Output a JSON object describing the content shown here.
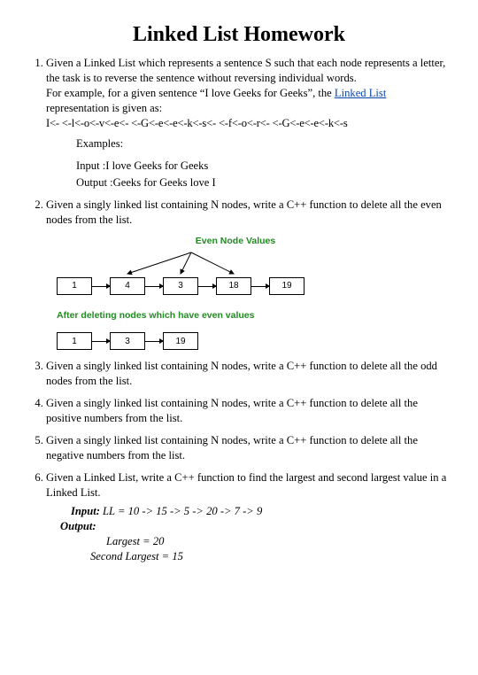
{
  "title": "Linked List Homework",
  "q1": {
    "p1": "Given a Linked List which represents a sentence S such that each node represents a letter, the task is to reverse the sentence without reversing individual words.",
    "p2a": "For example, for a given sentence “I love Geeks for Geeks”, the ",
    "link": "Linked List",
    "p2b": " representation is given as:",
    "rep": "I<- <-l<-o<-v<-e<- <-G<-e<-e<-k<-s<- <-f<-o<-r<- <-G<-e<-e<-k<-s",
    "examples_label": "Examples:",
    "input": "Input :I love Geeks for Geeks",
    "output": "Output :Geeks for Geeks love I"
  },
  "q2": {
    "text": "Given a singly linked list containing N nodes, write a C++ function to delete all the even nodes from the list.",
    "diag_title": "Even Node Values",
    "before": [
      "1",
      "4",
      "3",
      "18",
      "19"
    ],
    "after_label": "After deleting nodes which have even values",
    "after": [
      "1",
      "3",
      "19"
    ]
  },
  "q3": "Given a singly linked list containing N nodes, write a C++ function to delete all the odd nodes from the list.",
  "q4": "Given a singly linked list containing N nodes, write a C++ function to delete all the positive numbers from the list.",
  "q5": "Given a singly linked list containing N nodes, write a C++ function to delete all the negative numbers from the list.",
  "q6": {
    "text": "Given a Linked List, write a C++ function to find the largest and second largest value in a Linked List.",
    "input_label": "Input:",
    "input_val": " LL = 10 -> 15 -> 5 -> 20 -> 7 -> 9",
    "output_label": "Output:",
    "largest": "Largest = 20",
    "second": "Second Largest = 15"
  }
}
